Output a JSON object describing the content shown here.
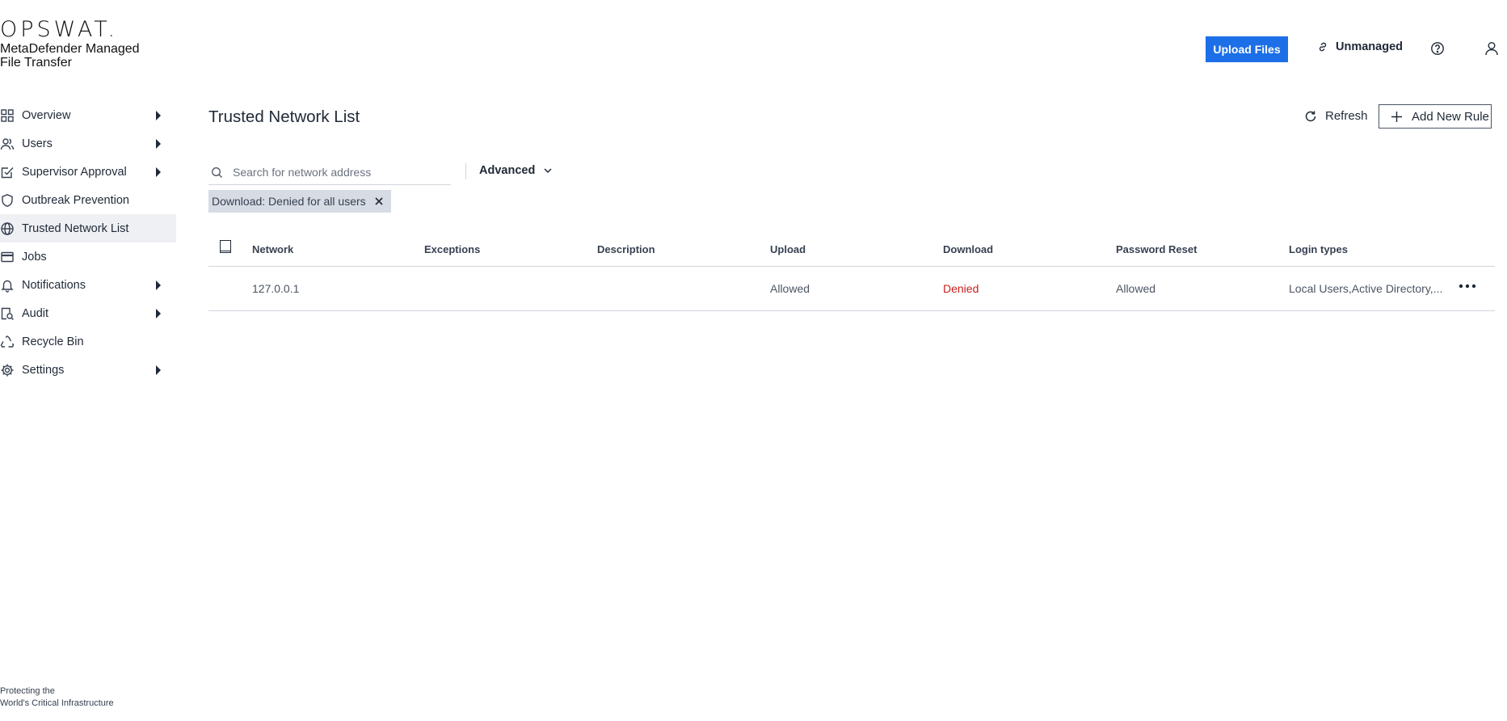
{
  "brand": {
    "logo": "OPSWAT.",
    "product_name": "MetaDefender Managed File Transfer",
    "tagline_line1": "Protecting the",
    "tagline_line2": "World's Critical Infrastructure"
  },
  "sidebar": {
    "items": [
      {
        "label": "Overview",
        "icon": "grid-icon",
        "has_submenu": true
      },
      {
        "label": "Users",
        "icon": "users-icon",
        "has_submenu": true
      },
      {
        "label": "Supervisor Approval",
        "icon": "approval-icon",
        "has_submenu": true
      },
      {
        "label": "Outbreak Prevention",
        "icon": "shield-icon",
        "has_submenu": false
      },
      {
        "label": "Trusted Network List",
        "icon": "globe-icon",
        "has_submenu": false,
        "active": true
      },
      {
        "label": "Jobs",
        "icon": "jobs-icon",
        "has_submenu": false
      },
      {
        "label": "Notifications",
        "icon": "bell-icon",
        "has_submenu": true
      },
      {
        "label": "Audit",
        "icon": "audit-icon",
        "has_submenu": true
      },
      {
        "label": "Recycle Bin",
        "icon": "recycle-icon",
        "has_submenu": false
      },
      {
        "label": "Settings",
        "icon": "gear-icon",
        "has_submenu": true
      }
    ]
  },
  "header": {
    "upload_label": "Upload Files",
    "unmanaged_label": "Unmanaged",
    "accent_color": "#1d6fe8"
  },
  "main": {
    "title": "Trusted Network List",
    "refresh_label": "Refresh",
    "add_rule_label": "Add New Rule",
    "search_placeholder": "Search for network address",
    "advanced_label": "Advanced",
    "filter_chip": "Download: Denied for all users"
  },
  "table": {
    "columns": [
      "Network",
      "Exceptions",
      "Description",
      "Upload",
      "Download",
      "Password Reset",
      "Login types"
    ],
    "rows": [
      {
        "network": "127.0.0.1",
        "exceptions": "",
        "description": "",
        "upload": "Allowed",
        "download": "Denied",
        "password_reset": "Allowed",
        "login_types": "Local Users,Active Directory,..."
      }
    ],
    "denied_color": "#c81e1e"
  }
}
